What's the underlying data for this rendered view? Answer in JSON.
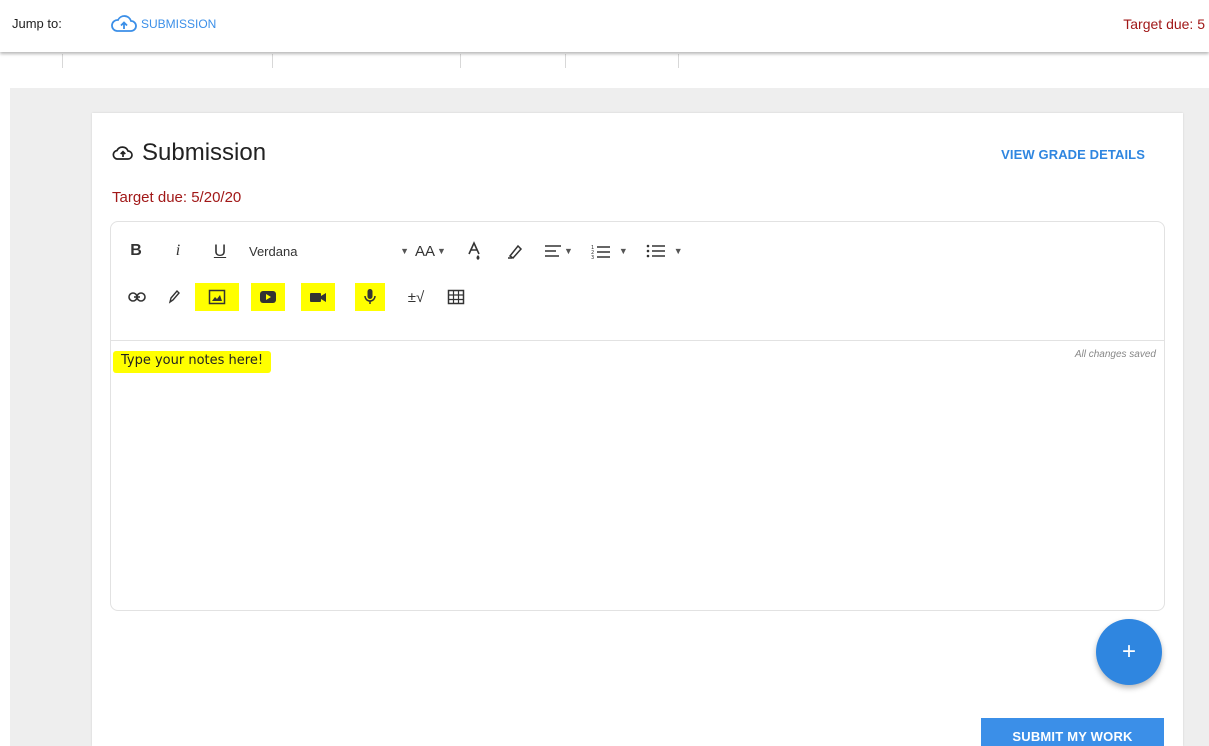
{
  "jumpbar": {
    "label": "Jump to:",
    "link_label": "SUBMISSION",
    "target_due": "Target due: 5"
  },
  "card": {
    "title": "Submission",
    "view_grade_label": "VIEW GRADE DETAILS",
    "target_due": "Target due: 5/20/20"
  },
  "toolbar": {
    "bold": "B",
    "italic": "i",
    "underline": "U",
    "font": "Verdana",
    "font_size": "AA",
    "math": "±√"
  },
  "editor": {
    "status": "All changes saved",
    "text": "Type your notes here!"
  },
  "fab_label": "+",
  "submit_label": "SUBMIT MY WORK",
  "colors": {
    "accent": "#2f86e0",
    "due_red": "#a11818",
    "highlight": "#ffff00",
    "background": "#eeeeee"
  }
}
